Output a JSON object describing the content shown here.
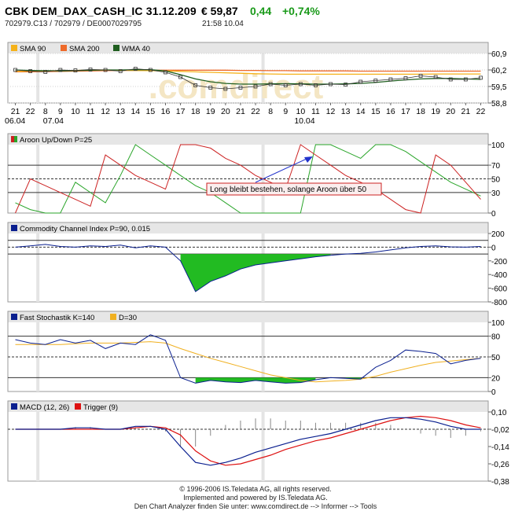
{
  "header": {
    "title": "CBK DEM_DAX_CASH_IC 31.12.209",
    "price": "€ 59,87",
    "change": "0,44",
    "change_pct": "+0,74%",
    "ids": "702979.C13  /  702979  /  DE0007029795",
    "time": "21:58   10.04"
  },
  "colors": {
    "sma90": "#f5b21b",
    "sma200": "#ee6a2a",
    "wma40": "#1f5e1f",
    "price": "#333333",
    "aroon_up": "#2aa52a",
    "aroon_down": "#cc2222",
    "indicator": "#0a1f8f",
    "fill_green": "#22bb22",
    "stoch_d": "#f0b020",
    "macd_trigger": "#dd1111",
    "panel_title_bg": "#e6e6e6",
    "grid": "#d0d0d0"
  },
  "watermark": ".comdirect",
  "footer": {
    "line1": "© 1996-2006 IS.Teledata AG, all rights reserved.",
    "line2": "Implemented and powered by IS.Teledata AG.",
    "line3": "Den Chart Analyzer finden Sie unter: www.comdirect.de --> Informer --> Tools"
  },
  "chart_data": [
    {
      "type": "line",
      "legend": [
        "SMA 90",
        "SMA 200",
        "WMA 40"
      ],
      "x_tick_labels": [
        "21",
        "22",
        "8",
        "9",
        "10",
        "11",
        "12",
        "13",
        "14",
        "15",
        "16",
        "17",
        "18",
        "19",
        "20",
        "21",
        "22",
        "8",
        "9",
        "10",
        "11",
        "12",
        "13",
        "14",
        "15",
        "16",
        "17",
        "18",
        "19",
        "20",
        "21",
        "22"
      ],
      "date_labels": [
        "06.04",
        "07.04",
        "10.04"
      ],
      "y_tick_labels": [
        "60,9",
        "60,2",
        "59,5",
        "58,8"
      ],
      "ylim": [
        58.8,
        60.9
      ],
      "series": [
        {
          "name": "SMA 90",
          "values": [
            60.14,
            60.15,
            60.16,
            60.17,
            60.18,
            60.2,
            60.2,
            60.19,
            60.18,
            60.17,
            60.16,
            60.14,
            60.12,
            60.1,
            60.08,
            60.06,
            60.04,
            60.03,
            60.02,
            60.02,
            60.02,
            60.02,
            60.02,
            60.02,
            60.02,
            60.02,
            60.02,
            60.02,
            60.03,
            60.03,
            60.03,
            60.03
          ]
        },
        {
          "name": "SMA 200",
          "values": [
            60.12,
            60.12,
            60.13,
            60.14,
            60.15,
            60.16,
            60.17,
            60.18,
            60.18,
            60.19,
            60.19,
            60.19,
            60.19,
            60.19,
            60.19,
            60.18,
            60.18,
            60.17,
            60.17,
            60.16,
            60.16,
            60.16,
            60.16,
            60.15,
            60.15,
            60.15,
            60.15,
            60.15,
            60.15,
            60.15,
            60.15,
            60.15
          ]
        },
        {
          "name": "WMA 40",
          "values": [
            60.2,
            60.18,
            60.17,
            60.16,
            60.17,
            60.19,
            60.2,
            60.2,
            60.21,
            60.21,
            60.16,
            60.0,
            59.82,
            59.7,
            59.63,
            59.6,
            59.6,
            59.61,
            59.62,
            59.61,
            59.6,
            59.6,
            59.61,
            59.63,
            59.67,
            59.73,
            59.78,
            59.82,
            59.84,
            59.84,
            59.82,
            59.8
          ]
        },
        {
          "name": "Kurs",
          "values": [
            60.2,
            60.15,
            60.12,
            60.2,
            60.18,
            60.22,
            60.2,
            60.15,
            60.25,
            60.2,
            60.1,
            59.9,
            59.55,
            59.45,
            59.4,
            59.45,
            59.5,
            59.6,
            59.55,
            59.6,
            59.55,
            59.6,
            59.58,
            59.7,
            59.75,
            59.8,
            59.85,
            59.95,
            59.9,
            59.8,
            59.8,
            59.87
          ]
        }
      ]
    },
    {
      "type": "line",
      "title": "Aroon Up/Down P=25",
      "y_tick_labels": [
        "100",
        "70",
        "50",
        "30",
        "0"
      ],
      "ylim": [
        0,
        100
      ],
      "annotation": "Long bleibt bestehen, solange Aroon über 50",
      "series": [
        {
          "name": "Aroon Up",
          "values": [
            15,
            5,
            0,
            0,
            45,
            30,
            15,
            55,
            100,
            85,
            70,
            55,
            40,
            30,
            15,
            0,
            0,
            0,
            0,
            0,
            100,
            100,
            90,
            80,
            100,
            100,
            90,
            75,
            60,
            45,
            35,
            25
          ]
        },
        {
          "name": "Aroon Down",
          "values": [
            0,
            50,
            40,
            30,
            20,
            10,
            85,
            70,
            55,
            45,
            35,
            100,
            100,
            95,
            80,
            70,
            55,
            45,
            35,
            100,
            85,
            70,
            55,
            45,
            35,
            20,
            5,
            0,
            85,
            70,
            45,
            20
          ]
        }
      ]
    },
    {
      "type": "area",
      "title": "Commodity Channel Index P=90, 0.015",
      "y_tick_labels": [
        "200",
        "0",
        "-200",
        "-400",
        "-600",
        "-800"
      ],
      "ylim": [
        -800,
        200
      ],
      "guide_levels": [
        100,
        -100
      ],
      "values": [
        0,
        20,
        40,
        10,
        0,
        20,
        10,
        30,
        -10,
        20,
        0,
        -200,
        -650,
        -500,
        -420,
        -320,
        -260,
        -230,
        -200,
        -170,
        -140,
        -120,
        -100,
        -90,
        -70,
        -40,
        -10,
        10,
        20,
        5,
        0,
        10
      ]
    },
    {
      "type": "line",
      "title": "Fast Stochastik K=140",
      "y_tick_labels": [
        "100",
        "80",
        "50",
        "20",
        "0"
      ],
      "ylim": [
        0,
        100
      ],
      "series": [
        {
          "name": "Fast Stochastik K=140",
          "values": [
            75,
            70,
            68,
            75,
            70,
            74,
            62,
            70,
            68,
            82,
            74,
            20,
            12,
            16,
            14,
            13,
            16,
            14,
            12,
            13,
            17,
            20,
            19,
            18,
            35,
            45,
            60,
            58,
            55,
            40,
            45,
            48
          ]
        },
        {
          "name": "D=30",
          "values": [
            68,
            68,
            68,
            68,
            69,
            70,
            70,
            70,
            71,
            72,
            70,
            62,
            55,
            48,
            42,
            36,
            30,
            24,
            20,
            16,
            14,
            15,
            16,
            18,
            22,
            28,
            33,
            38,
            42,
            44,
            46,
            48
          ]
        }
      ]
    },
    {
      "type": "line",
      "title": "MACD (12, 26)",
      "y_tick_labels": [
        "0,10",
        "-0,02",
        "-0,14",
        "-0,26",
        "-0,38"
      ],
      "ylim": [
        -0.38,
        0.1
      ],
      "series": [
        {
          "name": "MACD (12, 26)",
          "values": [
            -0.02,
            -0.02,
            -0.02,
            -0.02,
            -0.01,
            -0.01,
            -0.02,
            -0.02,
            0.0,
            0.0,
            -0.02,
            -0.14,
            -0.25,
            -0.27,
            -0.25,
            -0.22,
            -0.18,
            -0.15,
            -0.12,
            -0.09,
            -0.07,
            -0.05,
            -0.02,
            0.01,
            0.04,
            0.06,
            0.06,
            0.05,
            0.03,
            0.0,
            -0.02,
            -0.02
          ]
        },
        {
          "name": "Trigger (9)",
          "values": [
            -0.02,
            -0.02,
            -0.02,
            -0.02,
            -0.02,
            -0.02,
            -0.02,
            -0.02,
            -0.01,
            0.0,
            -0.01,
            -0.06,
            -0.17,
            -0.24,
            -0.27,
            -0.26,
            -0.23,
            -0.2,
            -0.16,
            -0.13,
            -0.1,
            -0.08,
            -0.05,
            -0.02,
            0.01,
            0.04,
            0.06,
            0.07,
            0.06,
            0.04,
            0.01,
            -0.01
          ]
        }
      ]
    }
  ]
}
